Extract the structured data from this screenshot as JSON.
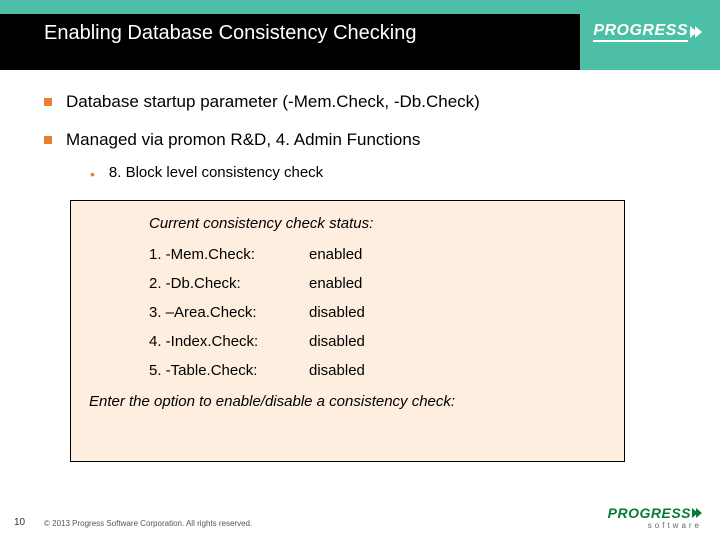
{
  "header": {
    "title": "Enabling Database Consistency Checking",
    "brand": "PROGRESS"
  },
  "bullets": {
    "b1": "Database startup parameter (-Mem.Check, -Db.Check)",
    "b2": "Managed via promon R&D,  4. Admin Functions",
    "b2a": "8. Block level consistency check"
  },
  "box": {
    "status_title": "Current consistency check status:",
    "rows": [
      {
        "label": "1. -Mem.Check:",
        "value": "enabled"
      },
      {
        "label": "2. -Db.Check:",
        "value": "enabled"
      },
      {
        "label": "3. –Area.Check:",
        "value": "disabled"
      },
      {
        "label": "4. -Index.Check:",
        "value": "disabled"
      },
      {
        "label": "5. -Table.Check:",
        "value": "disabled"
      }
    ],
    "prompt": "Enter the option to enable/disable a consistency check:"
  },
  "footer": {
    "page": "10",
    "copyright": "© 2013 Progress Software Corporation. All rights reserved.",
    "brand": "PROGRESS",
    "brand_sub": "software"
  }
}
